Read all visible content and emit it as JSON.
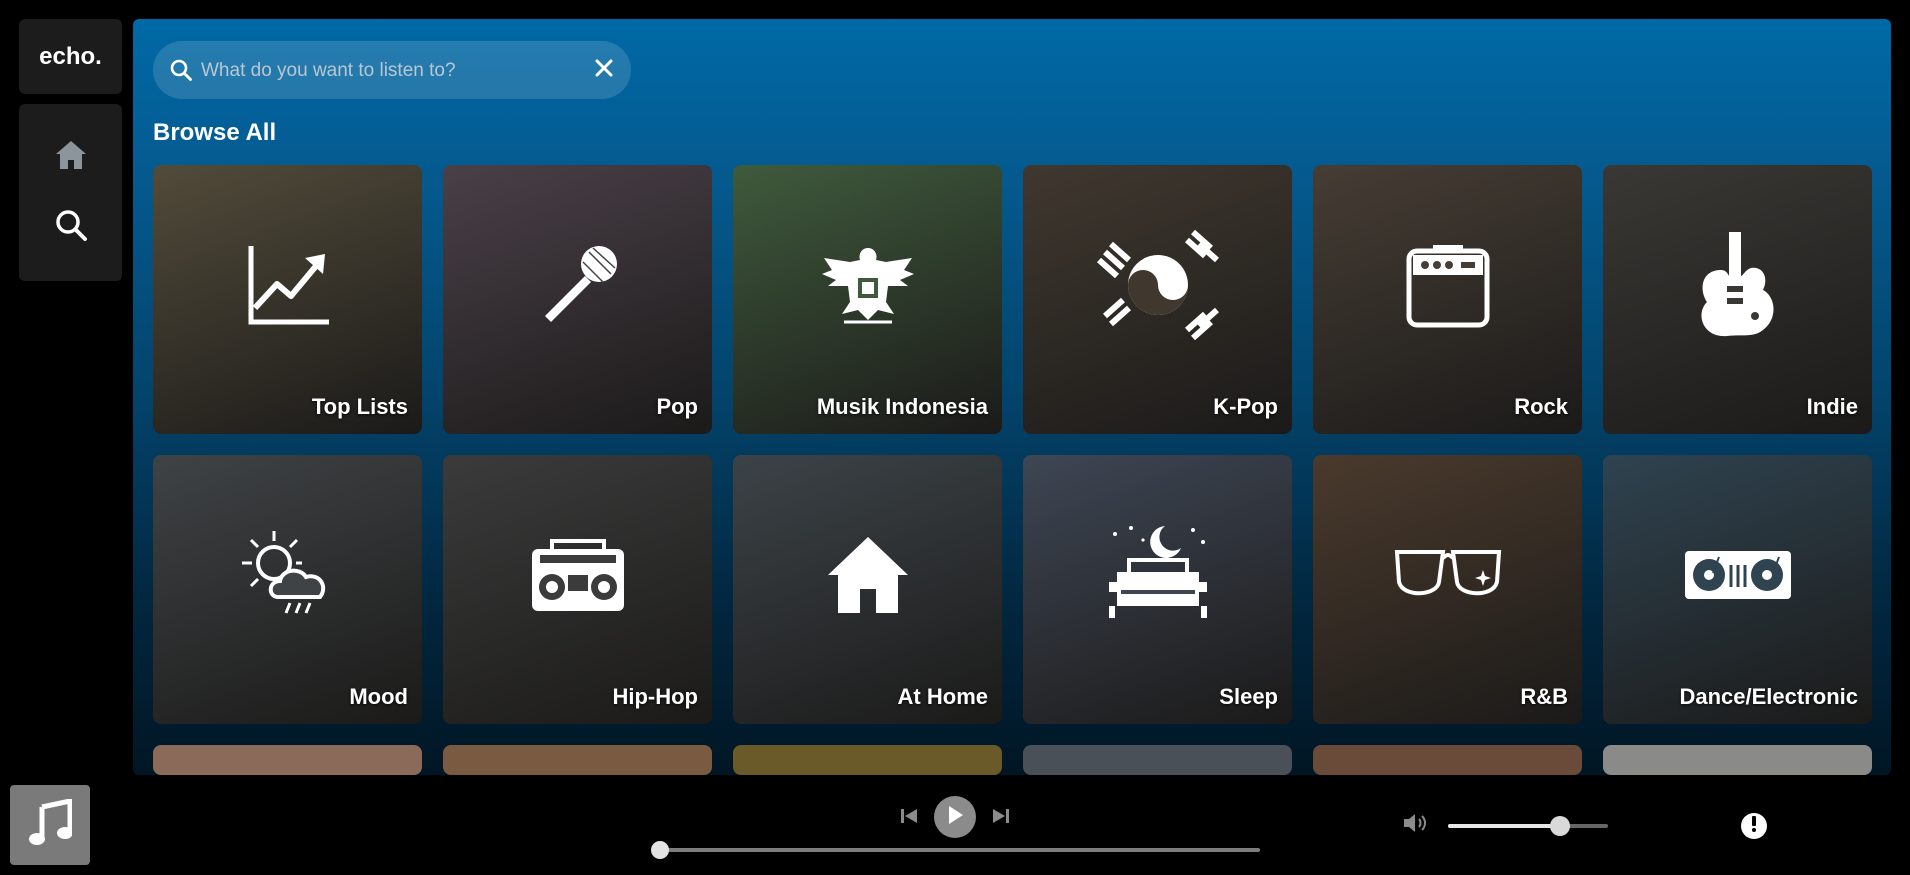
{
  "app": {
    "brand": "echo."
  },
  "nav": {
    "items": [
      {
        "icon": "home-icon"
      },
      {
        "icon": "search-icon"
      }
    ]
  },
  "search": {
    "placeholder": "What do you want to listen to?",
    "value": ""
  },
  "browse": {
    "heading": "Browse All",
    "categories": [
      {
        "label": "Top Lists",
        "icon": "chart-trend-icon",
        "bg": "#524b3a"
      },
      {
        "label": "Pop",
        "icon": "microphone-icon",
        "bg": "#4a4048"
      },
      {
        "label": "Musik Indonesia",
        "icon": "garuda-icon",
        "bg": "#3f5a3c"
      },
      {
        "label": "K-Pop",
        "icon": "korean-flag-icon",
        "bg": "#40382f"
      },
      {
        "label": "Rock",
        "icon": "amplifier-icon",
        "bg": "#463d34"
      },
      {
        "label": "Indie",
        "icon": "electric-guitar-icon",
        "bg": "#3a3834"
      },
      {
        "label": "Mood",
        "icon": "sun-cloud-rain-icon",
        "bg": "#3f4345"
      },
      {
        "label": "Hip-Hop",
        "icon": "boombox-icon",
        "bg": "#3b3b3b"
      },
      {
        "label": "At Home",
        "icon": "house-icon",
        "bg": "#3c4348"
      },
      {
        "label": "Sleep",
        "icon": "bed-moon-icon",
        "bg": "#3e4654"
      },
      {
        "label": "R&B",
        "icon": "sunglasses-icon",
        "bg": "#4a3a2c"
      },
      {
        "label": "Dance/Electronic",
        "icon": "turntable-icon",
        "bg": "#2f4350"
      }
    ],
    "partial_row_colors": [
      "#8c6a5a",
      "#7a5a40",
      "#6a5a2a",
      "#4a5058",
      "#6a4a38",
      "#8a8a88"
    ]
  },
  "player": {
    "album_icon": "music-note-icon",
    "controls": [
      "previous-icon",
      "play-icon",
      "next-icon"
    ],
    "progress": 0,
    "volume": 0.7,
    "info_icon": "exclamation-icon"
  }
}
